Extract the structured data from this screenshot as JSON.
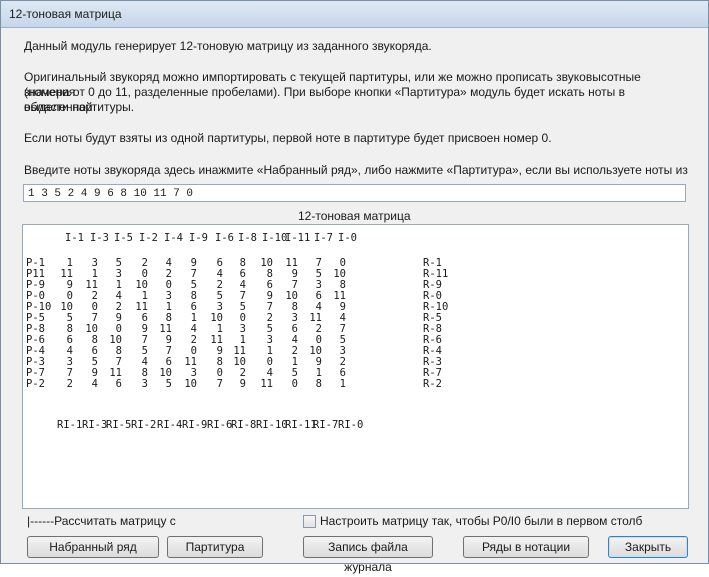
{
  "window": {
    "title": "12-тоновая матрица"
  },
  "intro": {
    "line1": "Данный модуль генерирует 12-тоновую матрицу из заданного звукоряда.",
    "para2": [
      "Оригинальный звукоряд можно импортировать с текущей партитуры, или же можно прописать звуковысотные значения",
      "(номера от 0 до 11, разделенные пробелами). При выборе кнопки «Партитура» модуль будет искать ноты в выделенной",
      "области партитуры."
    ],
    "line3": "Если ноты будут взяты из одной партитуры, первой ноте в партитуре будет присвоен номер 0.",
    "line4": "Введите ноты звукоряда здесь инажмите «Набранный ряд», либо нажмите «Партитура», если вы используете ноты из"
  },
  "row_input": {
    "value": "1 3 5 2 4 9 6 8 10 11 7 0"
  },
  "matrix": {
    "title": "12-тоновая матрица",
    "inversion_headers": [
      "I-1",
      "I-3",
      "I-5",
      "I-2",
      "I-4",
      "I-9",
      "I-6",
      "I-8",
      "I-10",
      "I-11",
      "I-7",
      "I-0"
    ],
    "retro_inversion_footers": [
      "RI-1",
      "RI-3",
      "RI-5",
      "RI-2",
      "RI-4",
      "RI-9",
      "RI-6",
      "RI-8",
      "RI-10",
      "RI-11",
      "RI-7",
      "RI-0"
    ],
    "rows": [
      {
        "p": "P-1",
        "v": [
          1,
          3,
          5,
          2,
          4,
          9,
          6,
          8,
          10,
          11,
          7,
          0
        ],
        "r": "R-1"
      },
      {
        "p": "P11",
        "v": [
          11,
          1,
          3,
          0,
          2,
          7,
          4,
          6,
          8,
          9,
          5,
          10
        ],
        "r": "R-11"
      },
      {
        "p": "P-9",
        "v": [
          9,
          11,
          1,
          10,
          0,
          5,
          2,
          4,
          6,
          7,
          3,
          8
        ],
        "r": "R-9"
      },
      {
        "p": "P-0",
        "v": [
          0,
          2,
          4,
          1,
          3,
          8,
          5,
          7,
          9,
          10,
          6,
          11
        ],
        "r": "R-0"
      },
      {
        "p": "P-10",
        "v": [
          10,
          0,
          2,
          11,
          1,
          6,
          3,
          5,
          7,
          8,
          4,
          9
        ],
        "r": "R-10"
      },
      {
        "p": "P-5",
        "v": [
          5,
          7,
          9,
          6,
          8,
          1,
          10,
          0,
          2,
          3,
          11,
          4
        ],
        "r": "R-5"
      },
      {
        "p": "P-8",
        "v": [
          8,
          10,
          0,
          9,
          11,
          4,
          1,
          3,
          5,
          6,
          2,
          7
        ],
        "r": "R-8"
      },
      {
        "p": "P-6",
        "v": [
          6,
          8,
          10,
          7,
          9,
          2,
          11,
          1,
          3,
          4,
          0,
          5
        ],
        "r": "R-6"
      },
      {
        "p": "P-4",
        "v": [
          4,
          6,
          8,
          5,
          7,
          0,
          9,
          11,
          1,
          2,
          10,
          3
        ],
        "r": "R-4"
      },
      {
        "p": "P-3",
        "v": [
          3,
          5,
          7,
          4,
          6,
          11,
          8,
          10,
          0,
          1,
          9,
          2
        ],
        "r": "R-3"
      },
      {
        "p": "P-7",
        "v": [
          7,
          9,
          11,
          8,
          10,
          3,
          0,
          2,
          4,
          5,
          1,
          6
        ],
        "r": "R-7"
      },
      {
        "p": "P-2",
        "v": [
          2,
          4,
          6,
          3,
          5,
          10,
          7,
          9,
          11,
          0,
          8,
          1
        ],
        "r": "R-2"
      }
    ]
  },
  "options": {
    "calc_label": "|------Рассчитать матрицу с",
    "checkbox_label": "Настроить матрицу так, чтобы P0/I0 были в первом столб"
  },
  "buttons": {
    "typed_row": "Набранный ряд",
    "score": "Партитура",
    "log": "Запись файла журнала",
    "notation": "Ряды в нотации",
    "close": "Закрыть"
  }
}
